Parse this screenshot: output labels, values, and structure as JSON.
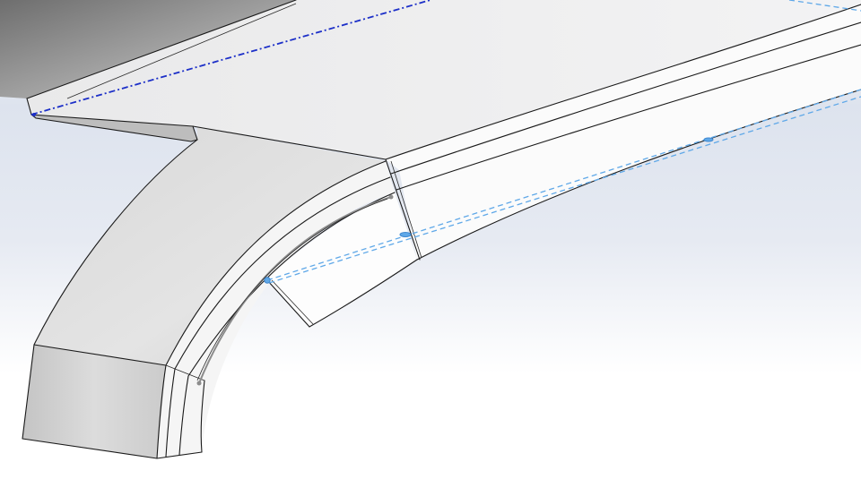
{
  "viewport": {
    "background_top": "#ced6e4",
    "background_bottom": "#ffffff"
  },
  "model": {
    "face_top_color": "#e6e7e9",
    "face_side_color": "#c9cacc",
    "face_light_color": "#f7f7f7",
    "edge_color": "#1a1a1a"
  },
  "references": {
    "primary_axis_color": "#1c2fc8",
    "secondary_axis_color": "#5fa8e8",
    "sketch_color": "#8c8c8c"
  }
}
